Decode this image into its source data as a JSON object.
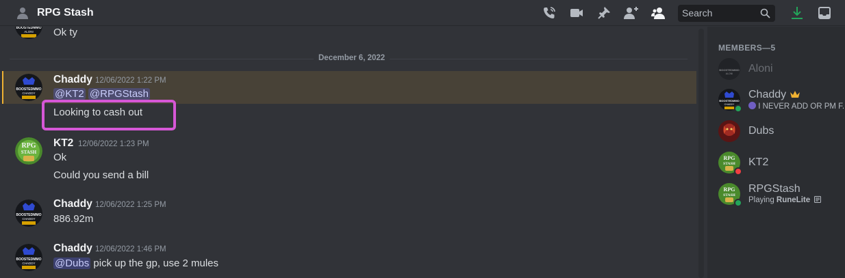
{
  "header": {
    "title": "RPG Stash",
    "search_placeholder": "Search"
  },
  "colors": {
    "accent_green": "#23a55a",
    "highlight_bar": "#f0b232",
    "annotation": "#d657d6",
    "mention_bg": "#5865f2"
  },
  "chat": {
    "date_divider": "December 6, 2022",
    "prev_message": {
      "text": "Ok ty"
    },
    "messages": [
      {
        "author": "Chaddy",
        "time": "12/06/2022 1:22 PM",
        "mention1": "@KT2",
        "mention2": "@RPGStash",
        "text": "Looking to cash out"
      },
      {
        "author": "KT2",
        "time": "12/06/2022 1:23 PM",
        "line1": "Ok",
        "line2": "Could you send a bill"
      },
      {
        "author": "Chaddy",
        "time": "12/06/2022 1:25 PM",
        "text": "886.92m"
      },
      {
        "author": "Chaddy",
        "time": "12/06/2022 1:46 PM",
        "mention": "@Dubs",
        "text": " pick up the gp, use 2 mules"
      }
    ]
  },
  "members": {
    "heading": "MEMBERS—5",
    "list": [
      {
        "name": "Aloni",
        "status": ""
      },
      {
        "name": "Chaddy",
        "status": "I NEVER ADD OR PM F..."
      },
      {
        "name": "Dubs",
        "status": ""
      },
      {
        "name": "KT2",
        "status": ""
      },
      {
        "name": "RPGStash",
        "status_prefix": "Playing ",
        "status_game": "RuneLite"
      }
    ]
  },
  "icons": [
    "people-icon",
    "phone-icon",
    "video-icon",
    "pin-icon",
    "add-friend-icon",
    "members-icon",
    "search-icon",
    "download-icon",
    "inbox-icon",
    "crown-icon"
  ]
}
